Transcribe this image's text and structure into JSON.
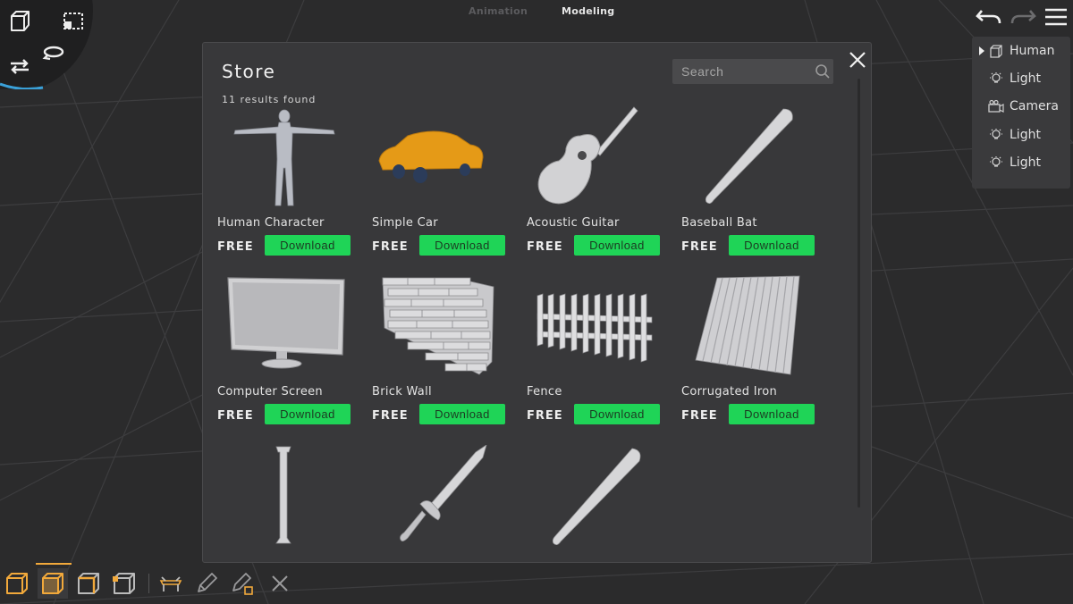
{
  "modes": {
    "animation": "Animation",
    "modeling": "Modeling"
  },
  "colors": {
    "accent": "#f2a93b",
    "download_button": "#1fd457",
    "background": "#2a2a2b",
    "panel": "#38383a"
  },
  "tool_wheel": {
    "icons": [
      "cube-icon",
      "marquee-select-icon",
      "swap-icon",
      "rotate-icon"
    ]
  },
  "top_right": {
    "icons": [
      "undo-icon",
      "redo-icon",
      "hamburger-menu-icon"
    ]
  },
  "outliner": {
    "items": [
      {
        "label": "Human",
        "icon": "object-icon"
      },
      {
        "label": "Light",
        "icon": "light-icon"
      },
      {
        "label": "Camera",
        "icon": "camera-icon"
      },
      {
        "label": "Light",
        "icon": "light-icon"
      },
      {
        "label": "Light",
        "icon": "light-icon"
      }
    ]
  },
  "store": {
    "title": "Store",
    "results": "11 results found",
    "search_placeholder": "Search",
    "items": [
      {
        "name": "Human Character",
        "price": "FREE",
        "button": "Download"
      },
      {
        "name": "Simple Car",
        "price": "FREE",
        "button": "Download"
      },
      {
        "name": "Acoustic Guitar",
        "price": "FREE",
        "button": "Download"
      },
      {
        "name": "Baseball Bat",
        "price": "FREE",
        "button": "Download"
      },
      {
        "name": "Computer Screen",
        "price": "FREE",
        "button": "Download"
      },
      {
        "name": "Brick Wall",
        "price": "FREE",
        "button": "Download"
      },
      {
        "name": "Fence",
        "price": "FREE",
        "button": "Download"
      },
      {
        "name": "Corrugated Iron",
        "price": "FREE",
        "button": "Download"
      }
    ]
  },
  "bottom_toolbar": {
    "icons": [
      "box-select-icon",
      "face-select-icon",
      "edge-select-icon",
      "vertex-select-icon",
      "table-tool-icon",
      "pencil-icon",
      "pencil-plus-icon",
      "delete-icon"
    ]
  }
}
